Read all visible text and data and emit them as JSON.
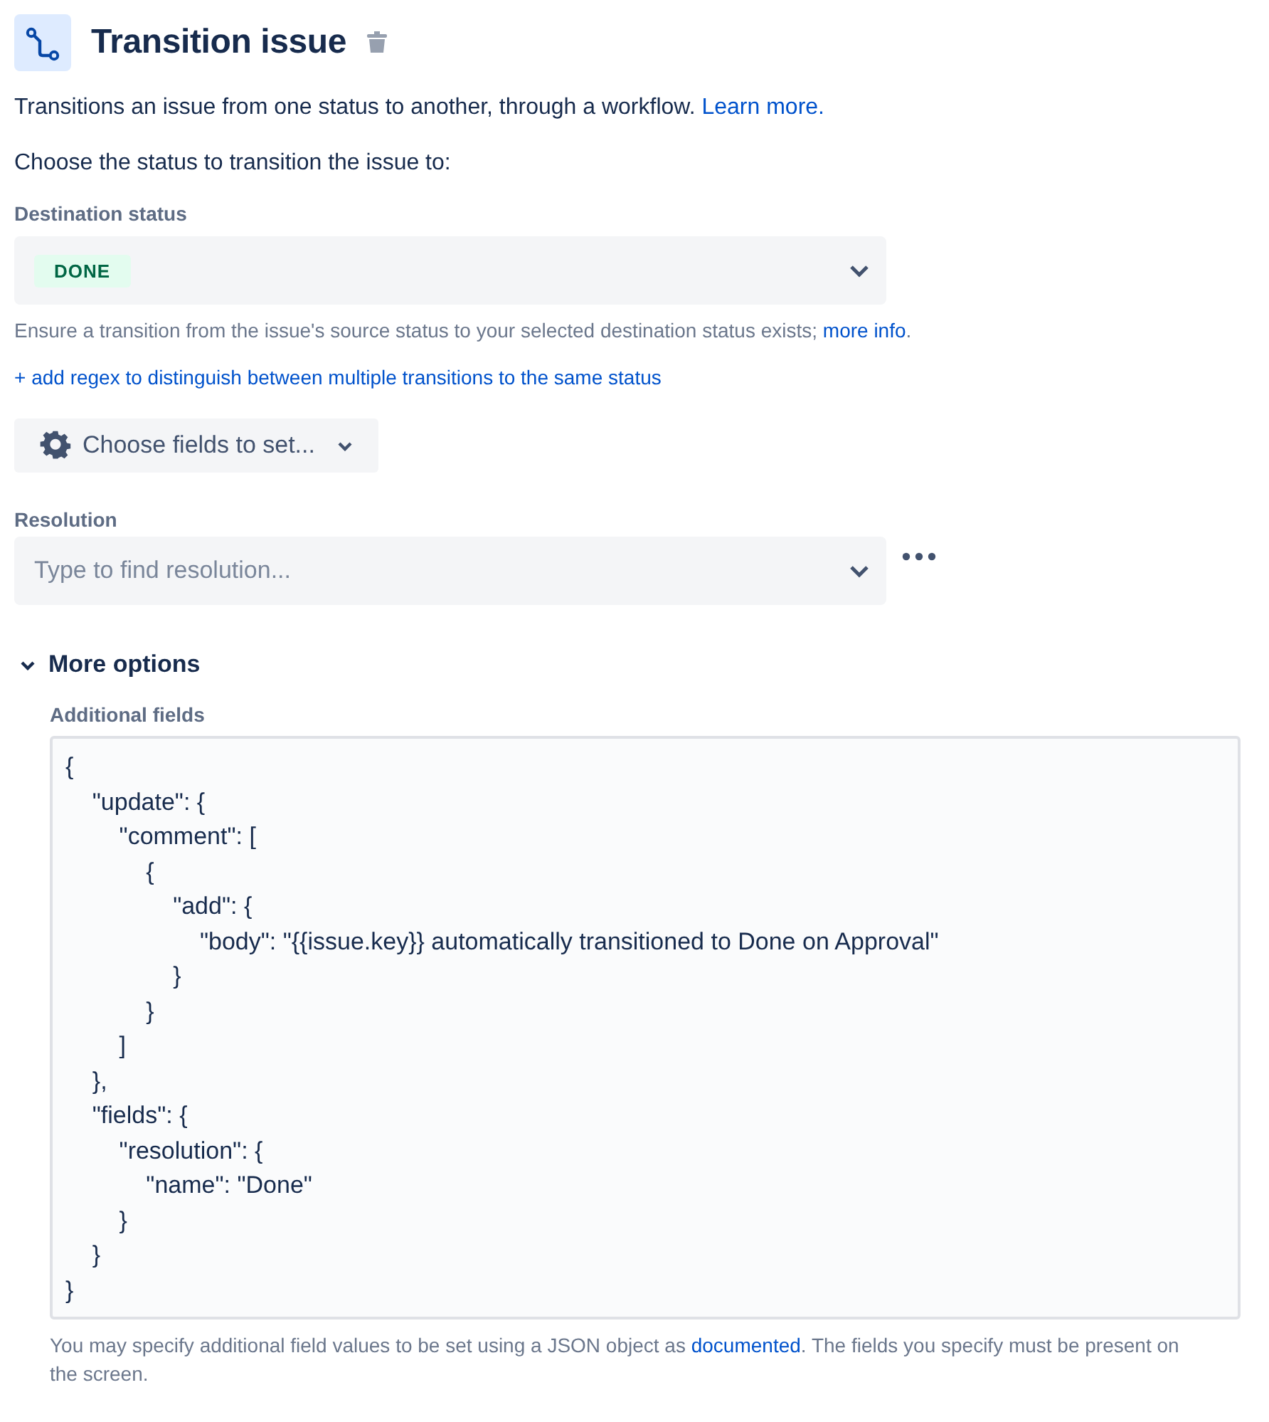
{
  "header": {
    "title": "Transition issue"
  },
  "description": {
    "text": "Transitions an issue from one status to another, through a workflow.",
    "link": "Learn more."
  },
  "prompt": "Choose the status to transition the issue to:",
  "destination": {
    "label": "Destination status",
    "value": "DONE",
    "help": "Ensure a transition from the issue's source status to your selected destination status exists;",
    "help_link": "more info",
    "help_end": "."
  },
  "regex_link": "+ add regex to distinguish between multiple transitions to the same status",
  "fields_button": "Choose fields to set...",
  "resolution": {
    "label": "Resolution",
    "placeholder": "Type to find resolution..."
  },
  "more_options": {
    "label": "More options",
    "expanded": true,
    "additional_fields": {
      "label": "Additional fields",
      "value": "{\n    \"update\": {\n        \"comment\": [\n            {\n                \"add\": {\n                    \"body\": \"{{issue.key}} automatically transitioned to Done on Approval\"\n                }\n            }\n        ]\n    },\n    \"fields\": {\n        \"resolution\": {\n            \"name\": \"Done\"\n        }\n    }\n}",
      "help": "You may specify additional field values to be set using a JSON object as",
      "help_link": "documented",
      "help_end": ". The fields you specify must be present on the screen."
    }
  }
}
